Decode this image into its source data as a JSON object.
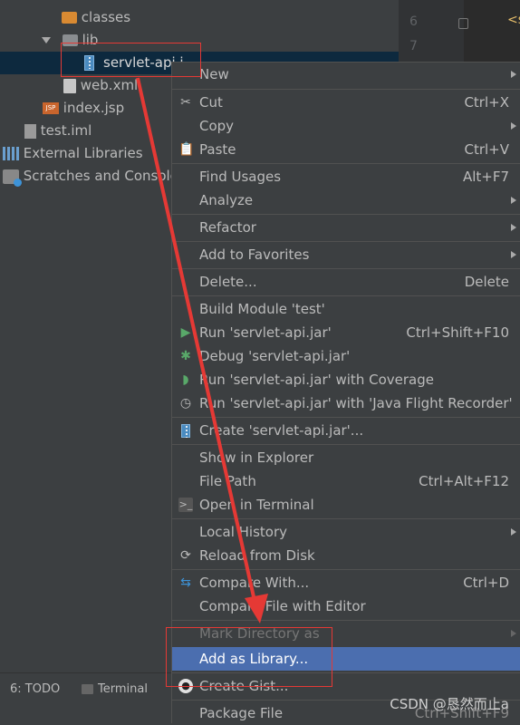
{
  "project_tree": {
    "items": [
      {
        "label": "classes",
        "icon": "folder-icon"
      },
      {
        "label": "lib",
        "icon": "folder-icon"
      },
      {
        "label": "servlet-api.j",
        "icon": "jar-file-icon"
      },
      {
        "label": "web.xml",
        "icon": "xml-file-icon"
      },
      {
        "label": "index.jsp",
        "icon": "jsp-file-icon"
      },
      {
        "label": "test.iml",
        "icon": "iml-file-icon"
      },
      {
        "label": "External Libraries",
        "icon": "libraries-icon"
      },
      {
        "label": "Scratches and Console",
        "icon": "scratches-icon"
      }
    ]
  },
  "editor": {
    "line_numbers": [
      "6",
      "7"
    ],
    "code_fragment": "<s"
  },
  "context_menu": {
    "items": [
      {
        "label": "New",
        "shortcut": "",
        "submenu": true
      },
      {
        "label": "Cut",
        "shortcut": "Ctrl+X",
        "icon": "scissors-icon"
      },
      {
        "label": "Copy",
        "shortcut": "",
        "submenu": true
      },
      {
        "label": "Paste",
        "shortcut": "Ctrl+V",
        "icon": "clipboard-icon"
      },
      {
        "label": "Find Usages",
        "shortcut": "Alt+F7"
      },
      {
        "label": "Analyze",
        "shortcut": "",
        "submenu": true
      },
      {
        "label": "Refactor",
        "shortcut": "",
        "submenu": true
      },
      {
        "label": "Add to Favorites",
        "shortcut": "",
        "submenu": true
      },
      {
        "label": "Delete...",
        "shortcut": "Delete"
      },
      {
        "label": "Build Module 'test'",
        "shortcut": ""
      },
      {
        "label": "Run 'servlet-api.jar'",
        "shortcut": "Ctrl+Shift+F10",
        "icon": "run-icon"
      },
      {
        "label": "Debug 'servlet-api.jar'",
        "shortcut": "",
        "icon": "debug-icon"
      },
      {
        "label": "Run 'servlet-api.jar' with Coverage",
        "shortcut": "",
        "icon": "coverage-icon"
      },
      {
        "label": "Run 'servlet-api.jar' with 'Java Flight Recorder'",
        "shortcut": "",
        "icon": "flight-recorder-icon"
      },
      {
        "label": "Create 'servlet-api.jar'...",
        "shortcut": "",
        "icon": "jar-config-icon"
      },
      {
        "label": "Show in Explorer",
        "shortcut": ""
      },
      {
        "label": "File Path",
        "shortcut": "Ctrl+Alt+F12"
      },
      {
        "label": "Open in Terminal",
        "shortcut": "",
        "icon": "terminal-icon"
      },
      {
        "label": "Local History",
        "shortcut": "",
        "submenu": true
      },
      {
        "label": "Reload from Disk",
        "shortcut": "",
        "icon": "reload-icon"
      },
      {
        "label": "Compare With...",
        "shortcut": "Ctrl+D",
        "icon": "compare-icon"
      },
      {
        "label": "Compare File with Editor",
        "shortcut": ""
      },
      {
        "label": "Mark Directory as",
        "shortcut": "",
        "submenu": true,
        "disabled": true
      },
      {
        "label": "Add as Library...",
        "shortcut": "",
        "highlighted": true
      },
      {
        "label": "Create Gist...",
        "shortcut": "",
        "icon": "github-icon"
      },
      {
        "label": "Package File",
        "shortcut": "Ctrl+Shift+F9"
      }
    ]
  },
  "bottom_bar": {
    "todo_label": "6: TODO",
    "terminal_label": "Terminal"
  },
  "watermark": "CSDN @恳然而止a",
  "colors": {
    "panel_bg": "#3c3f41",
    "selection_bg": "#0d293e",
    "highlight_bg": "#4b6eaf",
    "annotation_red": "#e53935"
  }
}
